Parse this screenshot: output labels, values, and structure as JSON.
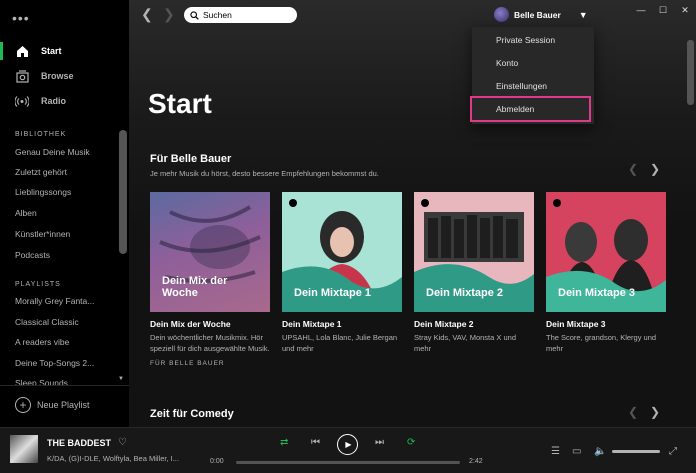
{
  "sidebar": {
    "nav": [
      {
        "label": "Start",
        "icon": "home-icon",
        "active": true
      },
      {
        "label": "Browse",
        "icon": "browse-icon",
        "active": false
      },
      {
        "label": "Radio",
        "icon": "radio-icon",
        "active": false
      }
    ],
    "library_heading": "BIBLIOTHEK",
    "library": [
      "Genau Deine Musik",
      "Zuletzt gehört",
      "Lieblingssongs",
      "Alben",
      "Künstler*innen",
      "Podcasts"
    ],
    "playlists_heading": "PLAYLISTS",
    "playlists": [
      "Morally Grey Fanta...",
      "Classical Classic",
      "A readers vibe",
      "Deine Top-Songs 2...",
      "Sleep Sounds"
    ],
    "new_playlist": "Neue Playlist"
  },
  "topbar": {
    "search_label": "Suchen",
    "user_name": "Belle Bauer"
  },
  "dropdown": {
    "items": [
      "Private Session",
      "Konto",
      "Einstellungen",
      "Abmelden"
    ],
    "highlighted": "Abmelden"
  },
  "main": {
    "page_title": "Start",
    "section1_title": "Für Belle Bauer",
    "section1_subtitle": "Je mehr Musik du hörst, desto bessere Empfehlungen bekommst du.",
    "section2_title": "Zeit für Comedy",
    "cards": [
      {
        "cover_text": "Dein Mix der Woche",
        "title": "Dein Mix der Woche",
        "desc": "Dein wöchentlicher Musikmix. Hör speziell für dich ausgewählte Musik.",
        "foot": "FÜR BELLE BAUER"
      },
      {
        "cover_text": "Dein Mixtape 1",
        "title": "Dein Mixtape 1",
        "desc": "UPSAHL, Lola Blanc, Julie Bergan und mehr",
        "foot": ""
      },
      {
        "cover_text": "Dein Mixtape 2",
        "title": "Dein Mixtape 2",
        "desc": "Stray Kids, VAV, Monsta X und mehr",
        "foot": ""
      },
      {
        "cover_text": "Dein Mixtape 3",
        "title": "Dein Mixtape 3",
        "desc": "The Score, grandson, Klergy und mehr",
        "foot": ""
      }
    ]
  },
  "player": {
    "track": "THE BADDEST",
    "artists": "K/DA, (G)I-DLE, Wolftyla, Bea Miller, I...",
    "elapsed": "0:00",
    "duration": "2:42",
    "progress_fraction": 0.0
  },
  "colors": {
    "accent": "#1db954",
    "highlight": "#e0388a"
  }
}
